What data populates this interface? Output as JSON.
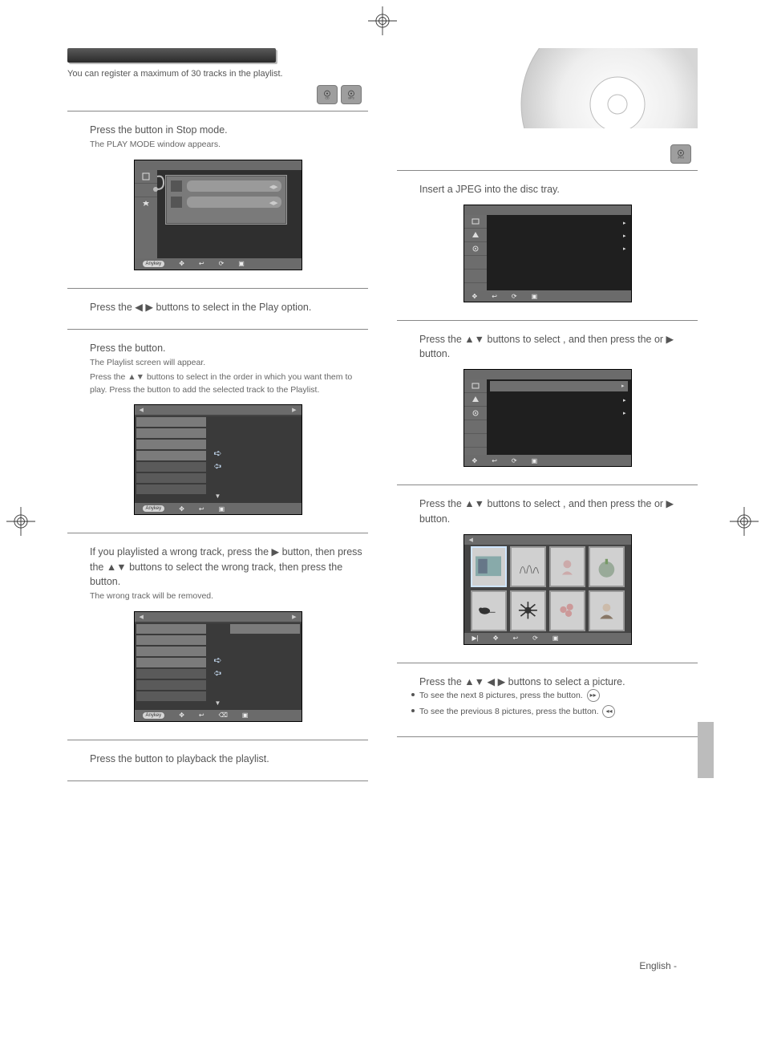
{
  "page": {
    "language_footer": "English -",
    "intro_left": "You can register a maximum of 30 tracks in the playlist."
  },
  "badges": {
    "left_col": [
      "CD",
      "MP3"
    ],
    "right_col": [
      "JPEG"
    ]
  },
  "left_steps": {
    "s1": {
      "line_a": "Press the ",
      "line_b": " button in Stop mode.",
      "sub": "The PLAY MODE window appears."
    },
    "s2": {
      "line": "Press the ◀ ▶ buttons to select            in the Play option."
    },
    "s3": {
      "line": "Press the       button.",
      "sub1": "The Playlist screen will appear.",
      "sub2": "Press the ▲▼ buttons to select            in the order in which you want them to play. Press the        button to add the selected track to the Playlist."
    },
    "s4": {
      "line": "If you playlisted a wrong track, press the ▶ button, then press the ▲▼ buttons to select the wrong track, then press the          button.",
      "sub": "The wrong track will be removed."
    },
    "s5": {
      "line": "Press the           button to playback the playlist."
    }
  },
  "right_steps": {
    "s1": {
      "line": "Insert a JPEG into the disc tray."
    },
    "s2": {
      "line": "Press the ▲▼ buttons to select              , and then press the        or ▶ button."
    },
    "s3": {
      "line": "Press the ▲▼ buttons to select          , and then press the        or ▶ button."
    },
    "s4": {
      "line": "Press the ▲▼ ◀ ▶ buttons to select a picture.",
      "b1": "To see the next 8 pictures, press the              button.",
      "b2": "To see the previous 8 pictures, press the              button."
    }
  },
  "osd": {
    "pill_label": "Anykey",
    "bottom_glyphs": [
      "✥",
      "↩",
      "⟳",
      "▣"
    ]
  }
}
